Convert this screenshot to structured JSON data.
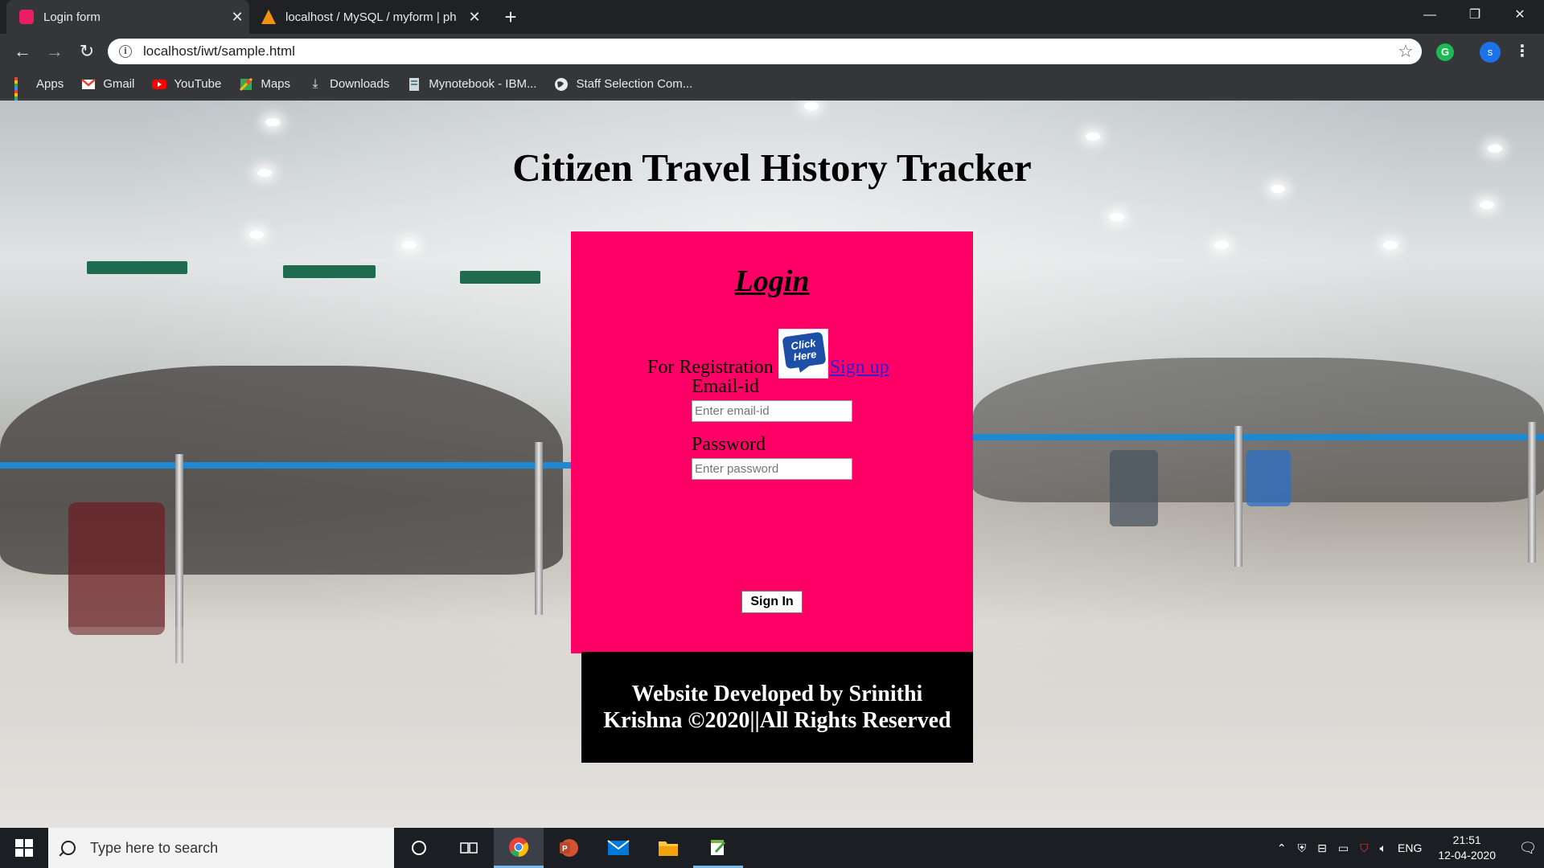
{
  "browser": {
    "tabs": [
      {
        "title": "Login form",
        "active": true,
        "favicon_color": "#e91e63"
      },
      {
        "title": "localhost / MySQL / myform | ph",
        "active": false,
        "favicon_color": "#f29111"
      }
    ],
    "url": "localhost/iwt/sample.html",
    "profile_initial": "s",
    "extension_initial": "G",
    "bookmarks": [
      {
        "label": "Apps",
        "icon": "apps-grid-icon"
      },
      {
        "label": "Gmail",
        "icon": "gmail-icon"
      },
      {
        "label": "YouTube",
        "icon": "youtube-icon"
      },
      {
        "label": "Maps",
        "icon": "maps-icon"
      },
      {
        "label": "Downloads",
        "icon": "download-icon"
      },
      {
        "label": "Mynotebook - IBM...",
        "icon": "notebook-icon"
      },
      {
        "label": "Staff Selection Com...",
        "icon": "globe-icon"
      }
    ]
  },
  "page": {
    "title": "Citizen Travel History Tracker",
    "login_heading": "Login",
    "registration_text": "For Registration",
    "click_here_badge": "Click Here",
    "signup_link": "Sign up",
    "email_label": "Email-id",
    "email_placeholder": "Enter email-id",
    "password_label": "Password",
    "password_placeholder": "Enter password",
    "signin_button": "Sign In",
    "footer": "Website Developed by Srinithi Krishna ©2020||All Rights Reserved",
    "colors": {
      "login_box": "#ff0066",
      "footer_box": "#000000"
    }
  },
  "taskbar": {
    "search_placeholder": "Type here to search",
    "language": "ENG",
    "time": "21:51",
    "date": "12-04-2020"
  }
}
